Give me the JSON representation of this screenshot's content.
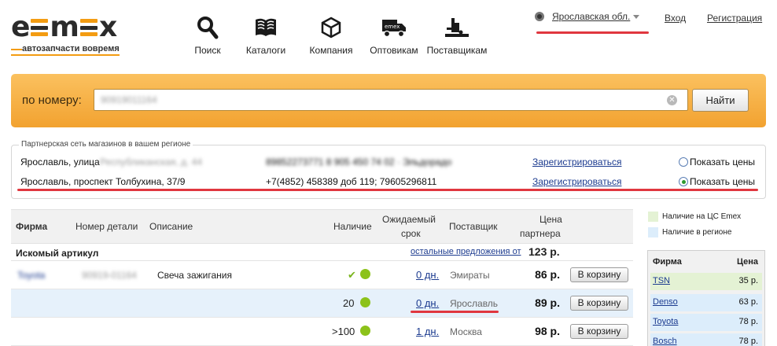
{
  "header": {
    "logo_word": "emex",
    "logo_tagline": "автозапчасти вовремя",
    "nav": [
      {
        "label": "Поиск",
        "icon": "search-icon"
      },
      {
        "label": "Каталоги",
        "icon": "book-icon"
      },
      {
        "label": "Компания",
        "icon": "box-icon"
      },
      {
        "label": "Оптовикам",
        "icon": "truck-icon"
      },
      {
        "label": "Поставщикам",
        "icon": "forklift-icon"
      }
    ],
    "region": "Ярославская обл.",
    "login": "Вход",
    "register": "Регистрация"
  },
  "search": {
    "label": "по номеру:",
    "value": "90919011164",
    "button": "Найти"
  },
  "partners": {
    "legend": "Партнерская сеть магазинов в вашем регионе",
    "rows": [
      {
        "city": "Ярославль, улица",
        "address": "Республиканская, д. 44",
        "phone": "89852273771 8 905 450 74 02 · Эльдорадо",
        "register": "Зарегистрироваться",
        "radio_label": "Показать цены",
        "selected": false
      },
      {
        "city": "Ярославль, проспект Толбухина, 37/9",
        "address": "",
        "phone": "+7(4852) 458389 доб 119; 79605296811",
        "register": "Зарегистрироваться",
        "radio_label": "Показать цены",
        "selected": true
      }
    ]
  },
  "results": {
    "columns": {
      "firm": "Фирма",
      "part_number": "Номер детали",
      "description": "Описание",
      "stock": "Наличие",
      "eta_line1": "Ожидаемый",
      "eta_line2": "срок",
      "supplier": "Поставщик",
      "price_line1": "Цена",
      "price_line2": "партнера"
    },
    "searched_label": "Искомый артикул",
    "other_offers": "остальные предложения от",
    "other_offers_price": "123 р.",
    "rows": [
      {
        "firm": "Toyota",
        "part": "90919-01164",
        "description": "Свеча зажигания",
        "stock": "✔",
        "eta": "0 дн.",
        "supplier": "Эмираты",
        "price": "86 р.",
        "button": "В корзину"
      },
      {
        "firm": "",
        "part": "",
        "description": "",
        "stock": "20",
        "eta": "0 дн.",
        "supplier": "Ярославль",
        "price": "89 р.",
        "button": "В корзину"
      },
      {
        "firm": "",
        "part": "",
        "description": "",
        "stock": ">100",
        "eta": "1 дн.",
        "supplier": "Москва",
        "price": "98 р.",
        "button": "В корзину"
      }
    ]
  },
  "legend": {
    "central": "Наличие на ЦС Emex",
    "region": "Наличие в регионе",
    "central_color": "#e4f2d4",
    "region_color": "#dcedfb"
  },
  "sidebar": {
    "col_firm": "Фирма",
    "col_price": "Цена",
    "rows": [
      {
        "firm": "TSN",
        "price": "35 р."
      },
      {
        "firm": "Denso",
        "price": "63 р."
      },
      {
        "firm": "Toyota",
        "price": "78 р."
      },
      {
        "firm": "Bosch",
        "price": "78 р."
      }
    ]
  },
  "colors": {
    "accent_orange": "#f2a230",
    "annotation_red": "#e0373f",
    "link_blue": "#1c3b8f",
    "stock_green": "#8cc21a"
  }
}
